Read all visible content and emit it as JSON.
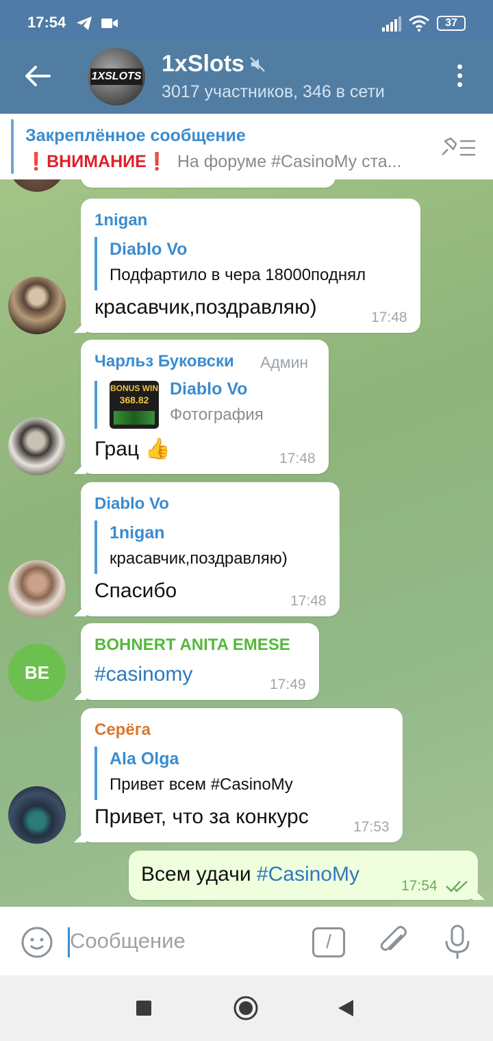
{
  "status": {
    "time": "17:54",
    "battery": "37"
  },
  "header": {
    "channel_logo_text": "1XSLOTS",
    "title": "1xSlots",
    "subtitle": "3017 участников, 346 в сети"
  },
  "pinned": {
    "title": "Закреплённое сообщение",
    "warning": "❗ВНИМАНИЕ❗",
    "text": "На форуме #CasinoMy ста..."
  },
  "messages": [
    {
      "sender": "1nigan",
      "sender_color": "#3a8cd0",
      "reply_name": "Diablo Vo",
      "reply_text": "Подфартило в чера 18000поднял",
      "text": "красавчик,поздравляю)",
      "time": "17:48"
    },
    {
      "sender": "Чарльз Буковски",
      "sender_color": "#3a8cd0",
      "badge": "Админ",
      "reply_name": "Diablo Vo",
      "reply_text": "Фотография",
      "reply_thumb_text": "BONUS WIN",
      "reply_thumb_value": "368.82",
      "text": "Грац 👍",
      "time": "17:48"
    },
    {
      "sender": "Diablo Vo",
      "sender_color": "#3a8cd0",
      "reply_name": "1nigan",
      "reply_text": "красавчик,поздравляю)",
      "text": "Спасибо",
      "time": "17:48"
    },
    {
      "sender": "BOHNERT ANITA EMESE",
      "sender_color": "#54b83c",
      "avatar_initials": "BE",
      "text": "#casinomy",
      "time": "17:49"
    },
    {
      "sender": "Серёга",
      "sender_color": "#d9782c",
      "reply_name": "Ala Olga",
      "reply_text": "Привет всем #CasinoMy",
      "text": "Привет, что за конкурс",
      "time": "17:53"
    },
    {
      "text_plain": "Всем удачи ",
      "text_tag": "#CasinoMy",
      "time": "17:54"
    }
  ],
  "input": {
    "placeholder": "Сообщение",
    "command_symbol": "/"
  }
}
